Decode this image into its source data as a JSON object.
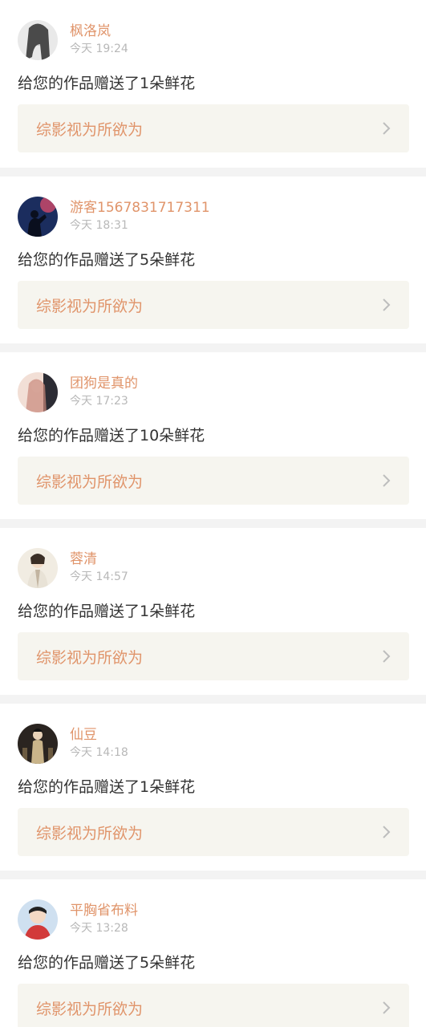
{
  "notifications": [
    {
      "username": "枫洛岚",
      "time": "今天 19:24",
      "message": "给您的作品赠送了1朵鲜花",
      "work_title": "综影视为所欲为",
      "avatar_colors": [
        "#e9e9e9",
        "#4a4a4a"
      ]
    },
    {
      "username": "游客1567831717311",
      "time": "今天 18:31",
      "message": "给您的作品赠送了5朵鲜花",
      "work_title": "综影视为所欲为",
      "avatar_colors": [
        "#1b2d5e",
        "#d24a6a"
      ]
    },
    {
      "username": "团狗是真的",
      "time": "今天 17:23",
      "message": "给您的作品赠送了10朵鲜花",
      "work_title": "综影视为所欲为",
      "avatar_colors": [
        "#f2dfd6",
        "#c9887a"
      ]
    },
    {
      "username": "蓉清",
      "time": "今天 14:57",
      "message": "给您的作品赠送了1朵鲜花",
      "work_title": "综影视为所欲为",
      "avatar_colors": [
        "#f1ece2",
        "#a8967c"
      ]
    },
    {
      "username": "仙豆",
      "time": "今天 14:18",
      "message": "给您的作品赠送了1朵鲜花",
      "work_title": "综影视为所欲为",
      "avatar_colors": [
        "#2a2420",
        "#c9b48a"
      ]
    },
    {
      "username": "平胸省布料",
      "time": "今天 13:28",
      "message": "给您的作品赠送了5朵鲜花",
      "work_title": "综影视为所欲为",
      "avatar_colors": [
        "#cfe0f0",
        "#d23a3a"
      ]
    }
  ],
  "chevron_icon": "chevron-right-icon"
}
